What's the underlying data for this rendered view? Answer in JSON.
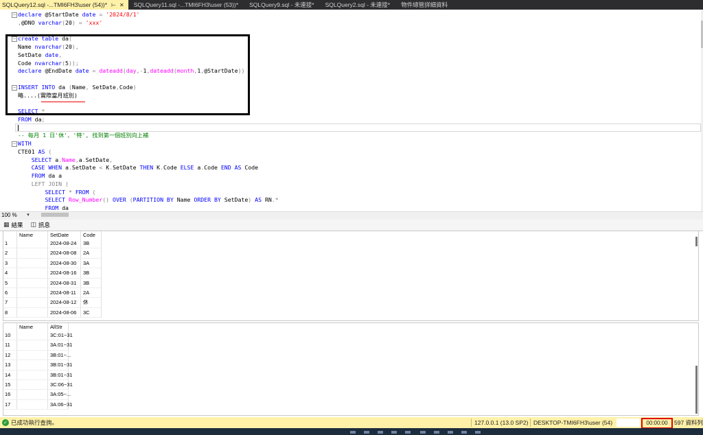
{
  "tabs": [
    {
      "label": "SQLQuery12.sql -...TMI6FH3\\user (54))*",
      "pin": "⊢",
      "close": "✕",
      "active": true
    },
    {
      "label": "SQLQuery11.sql -...TMI6FH3\\user (53))*",
      "active": false
    },
    {
      "label": "SQLQuery9.sql - 未連接*",
      "active": false
    },
    {
      "label": "SQLQuery2.sql - 未連接*",
      "active": false
    },
    {
      "label": "物件總管詳細資料",
      "active": false
    }
  ],
  "editor": {
    "lines": [
      [
        [
          "kw",
          "declare "
        ],
        [
          "",
          "@StartDate "
        ],
        [
          "kw",
          "date "
        ],
        [
          "gy",
          "= "
        ],
        [
          "str",
          "'2024/8/1'"
        ]
      ],
      [
        [
          "gy",
          ","
        ],
        [
          "",
          "@DNO "
        ],
        [
          "kw",
          "varchar"
        ],
        [
          "gy",
          "("
        ],
        [
          "",
          "20"
        ],
        [
          "gy",
          ") = "
        ],
        [
          "str",
          "'xxx'"
        ]
      ],
      [],
      [
        [
          "kw",
          "create table "
        ],
        [
          "",
          "da"
        ],
        [
          "gy",
          "("
        ]
      ],
      [
        [
          "",
          "Name "
        ],
        [
          "kw",
          "nvarchar"
        ],
        [
          "gy",
          "("
        ],
        [
          "",
          "20"
        ],
        [
          "gy",
          "),"
        ]
      ],
      [
        [
          "",
          "SetDate "
        ],
        [
          "kw",
          "date"
        ],
        [
          "gy",
          ","
        ]
      ],
      [
        [
          "",
          "Code "
        ],
        [
          "kw",
          "nvarchar"
        ],
        [
          "gy",
          "("
        ],
        [
          "",
          "5"
        ],
        [
          "gy",
          "));"
        ]
      ],
      [
        [
          "kw",
          "declare "
        ],
        [
          "",
          "@EndDate "
        ],
        [
          "kw",
          "date "
        ],
        [
          "gy",
          "= "
        ],
        [
          "fn",
          "dateadd"
        ],
        [
          "gy",
          "("
        ],
        [
          "fn",
          "day"
        ],
        [
          "gy",
          ",-"
        ],
        [
          "",
          "1"
        ],
        [
          "gy",
          ","
        ],
        [
          "fn",
          "dateadd"
        ],
        [
          "gy",
          "("
        ],
        [
          "fn",
          "month"
        ],
        [
          "gy",
          ","
        ],
        [
          "",
          "1"
        ],
        [
          "gy",
          ","
        ],
        [
          "",
          "@StartDate"
        ],
        [
          "gy",
          "))"
        ]
      ],
      [],
      [
        [
          "kw",
          "INSERT INTO "
        ],
        [
          "",
          "da "
        ],
        [
          "gy",
          "("
        ],
        [
          "",
          "Name"
        ],
        [
          "gy",
          ", "
        ],
        [
          "",
          "SetDate"
        ],
        [
          "gy",
          ","
        ],
        [
          "",
          "Code"
        ],
        [
          "gy",
          ")"
        ]
      ],
      [
        [
          "",
          "略....(實際當月班別)"
        ]
      ],
      [],
      [
        [
          "kw",
          "SELECT "
        ],
        [
          "gy",
          "*"
        ]
      ],
      [
        [
          "kw",
          "FROM "
        ],
        [
          "",
          "da"
        ],
        [
          "gy",
          ";"
        ]
      ],
      [],
      [
        [
          "cm",
          "-- 每月 1 日'休'、'特', 找到第一個班別向上補"
        ]
      ],
      [
        [
          "kw",
          "WITH"
        ]
      ],
      [
        [
          "",
          "CTE01 "
        ],
        [
          "kw",
          "AS "
        ],
        [
          "gy",
          "("
        ]
      ],
      [
        [
          "",
          "    "
        ],
        [
          "kw",
          "SELECT "
        ],
        [
          "",
          "a"
        ],
        [
          "gy",
          "."
        ],
        [
          "fn",
          "Name"
        ],
        [
          "gy",
          ","
        ],
        [
          "",
          "a"
        ],
        [
          "gy",
          "."
        ],
        [
          "",
          "SetDate"
        ],
        [
          "gy",
          ","
        ]
      ],
      [
        [
          "",
          "    "
        ],
        [
          "kw",
          "CASE WHEN "
        ],
        [
          "",
          "a"
        ],
        [
          "gy",
          "."
        ],
        [
          "",
          "SetDate "
        ],
        [
          "gy",
          "< "
        ],
        [
          "",
          "K"
        ],
        [
          "gy",
          "."
        ],
        [
          "",
          "SetDate "
        ],
        [
          "kw",
          "THEN "
        ],
        [
          "",
          "K"
        ],
        [
          "gy",
          "."
        ],
        [
          "",
          "Code "
        ],
        [
          "kw",
          "ELSE "
        ],
        [
          "",
          "a"
        ],
        [
          "gy",
          "."
        ],
        [
          "",
          "Code "
        ],
        [
          "kw",
          "END AS "
        ],
        [
          "",
          "Code"
        ]
      ],
      [
        [
          "",
          "    "
        ],
        [
          "kw",
          "FROM "
        ],
        [
          "",
          "da a"
        ]
      ],
      [
        [
          "",
          "    "
        ],
        [
          "gy",
          "LEFT JOIN "
        ],
        [
          "gy",
          "("
        ]
      ],
      [
        [
          "",
          "        "
        ],
        [
          "kw",
          "SELECT "
        ],
        [
          "gy",
          "* "
        ],
        [
          "kw",
          "FROM "
        ],
        [
          "gy",
          "("
        ]
      ],
      [
        [
          "",
          "        "
        ],
        [
          "kw",
          "SELECT "
        ],
        [
          "fn",
          "Row_Number"
        ],
        [
          "gy",
          "() "
        ],
        [
          "kw",
          "OVER "
        ],
        [
          "gy",
          "("
        ],
        [
          "kw",
          "PARTITION BY "
        ],
        [
          "",
          "Name "
        ],
        [
          "kw",
          "ORDER BY "
        ],
        [
          "",
          "SetDate"
        ],
        [
          "gy",
          ") "
        ],
        [
          "kw",
          "AS "
        ],
        [
          "",
          "RN"
        ],
        [
          "gy",
          ".*"
        ]
      ],
      [
        [
          "",
          "        "
        ],
        [
          "kw",
          "FROM "
        ],
        [
          "",
          "da"
        ]
      ]
    ]
  },
  "zoom": {
    "label": "100 %",
    "arrow": "▾"
  },
  "result_tabs": [
    {
      "icon": "▦",
      "label": "結果"
    },
    {
      "icon": "◫",
      "label": "訊息"
    }
  ],
  "grid1": {
    "columns": [
      "Name",
      "SetDate",
      "Code"
    ],
    "rows": [
      [
        "1",
        "",
        "2024-08-24",
        "3B"
      ],
      [
        "2",
        "",
        "2024-08-08",
        "2A"
      ],
      [
        "3",
        "",
        "2024-08-30",
        "3A"
      ],
      [
        "4",
        "",
        "2024-08-16",
        "3B"
      ],
      [
        "5",
        "",
        "2024-08-31",
        "3B"
      ],
      [
        "6",
        "",
        "2024-08-11",
        "2A"
      ],
      [
        "7",
        "",
        "2024-08-12",
        "休"
      ],
      [
        "8",
        "",
        "2024-08-06",
        "3C"
      ]
    ]
  },
  "grid2": {
    "columns": [
      "Name",
      "AllStr"
    ],
    "rows": [
      [
        "10",
        "",
        "3C:01~31"
      ],
      [
        "11",
        "",
        "3A:01~31"
      ],
      [
        "12",
        "",
        "3B:01~..."
      ],
      [
        "13",
        "",
        "3B:01~31"
      ],
      [
        "14",
        "",
        "3B:01~31"
      ],
      [
        "15",
        "",
        "3C:06~31"
      ],
      [
        "16",
        "",
        "3A:05~..."
      ],
      [
        "17",
        "",
        "3A:06~31"
      ]
    ]
  },
  "status": {
    "icon": "✓",
    "message": "已成功執行查詢。",
    "server": "127.0.0.1 (13.0 SP2)",
    "user": "DESKTOP-TMI6FH3\\user (54)",
    "time": "00:00:00",
    "rows": "597 資料列"
  },
  "colors": {
    "active_tab": "#fff1a8",
    "status_bar": "#fff1a8",
    "keyword": "#0000ff",
    "function": "#ff00ff",
    "string": "#ff0000",
    "comment": "#008000",
    "highlight_box": "#000000",
    "time_box": "#e00000"
  }
}
